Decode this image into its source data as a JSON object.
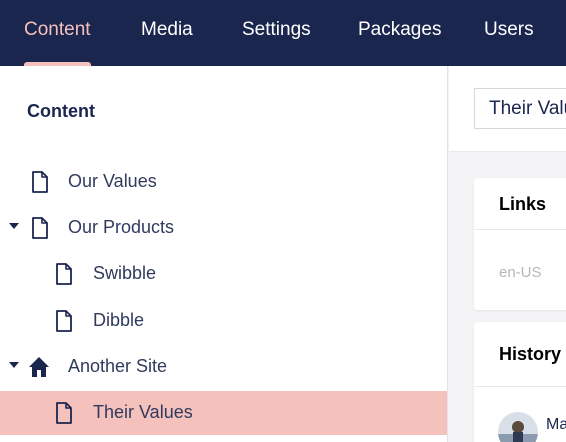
{
  "nav": {
    "items": [
      {
        "label": "Content"
      },
      {
        "label": "Media"
      },
      {
        "label": "Settings"
      },
      {
        "label": "Packages"
      },
      {
        "label": "Users"
      }
    ]
  },
  "sidebar": {
    "title": "Content",
    "tree": [
      {
        "label": "Our Values",
        "icon": "document-icon",
        "expanded": null,
        "selected": false
      },
      {
        "label": "Our Products",
        "icon": "document-icon",
        "expanded": true,
        "selected": false
      },
      {
        "label": "Swibble",
        "icon": "document-icon",
        "expanded": null,
        "selected": false
      },
      {
        "label": "Dibble",
        "icon": "document-icon",
        "expanded": null,
        "selected": false
      },
      {
        "label": "Another Site",
        "icon": "home-icon",
        "expanded": true,
        "selected": false
      },
      {
        "label": "Their Values",
        "icon": "document-icon",
        "expanded": null,
        "selected": true
      }
    ]
  },
  "editor": {
    "name_value": "Their Values",
    "links_card": {
      "title": "Links",
      "culture": "en-US"
    },
    "history_card": {
      "title": "History",
      "entry_name": "Ma"
    }
  },
  "colors": {
    "nav_bg": "#1b264f",
    "accent": "#f5c1bc",
    "selected_row": "#f5c1bc",
    "text": "#1b264f"
  }
}
